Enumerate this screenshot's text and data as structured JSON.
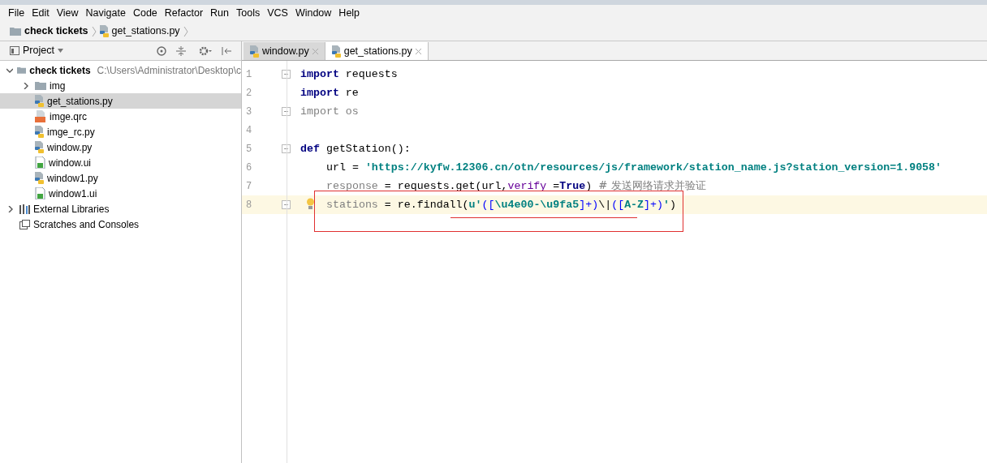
{
  "menu": [
    "File",
    "Edit",
    "View",
    "Navigate",
    "Code",
    "Refactor",
    "Run",
    "Tools",
    "VCS",
    "Window",
    "Help"
  ],
  "breadcrumb": [
    {
      "label": "check tickets",
      "kind": "folder"
    },
    {
      "label": "get_stations.py",
      "kind": "python"
    }
  ],
  "project_panel": {
    "title": "Project"
  },
  "tabs": [
    {
      "label": "window.py",
      "selected": false
    },
    {
      "label": "get_stations.py",
      "selected": true
    }
  ],
  "tree": [
    {
      "label": "check tickets",
      "path": "C:\\Users\\Administrator\\Desktop\\c",
      "kind": "folder",
      "expanded": true,
      "selected": false,
      "children": [
        {
          "label": "img",
          "kind": "folder",
          "expanded": false,
          "selected": false
        },
        {
          "label": "get_stations.py",
          "kind": "python",
          "selected": true
        },
        {
          "label": "imge.qrc",
          "kind": "qrc",
          "selected": false
        },
        {
          "label": "imge_rc.py",
          "kind": "python",
          "selected": false
        },
        {
          "label": "window.py",
          "kind": "python",
          "selected": false
        },
        {
          "label": "window.ui",
          "kind": "ui",
          "selected": false
        },
        {
          "label": "window1.py",
          "kind": "python",
          "selected": false
        },
        {
          "label": "window1.ui",
          "kind": "ui",
          "selected": false
        }
      ]
    },
    {
      "label": "External Libraries",
      "kind": "library",
      "expanded": false,
      "selected": false
    },
    {
      "label": "Scratches and Consoles",
      "kind": "scratch",
      "selected": false
    }
  ],
  "code_lines": [
    {
      "number": "1",
      "fold": true,
      "current": false,
      "indented": false,
      "tokens": [
        {
          "text": "import",
          "kind": "keyword"
        },
        {
          "text": " requests",
          "kind": "plain"
        }
      ]
    },
    {
      "number": "2",
      "fold": false,
      "current": false,
      "indented": false,
      "tokens": [
        {
          "text": "import",
          "kind": "keyword"
        },
        {
          "text": " re",
          "kind": "plain"
        }
      ]
    },
    {
      "number": "3",
      "fold": true,
      "current": false,
      "indented": false,
      "tokens": [
        {
          "text": "import os",
          "kind": "unused"
        }
      ]
    },
    {
      "number": "4",
      "fold": false,
      "current": false
    },
    {
      "number": "5",
      "fold": true,
      "current": false,
      "indented": false,
      "tokens": [
        {
          "text": "def",
          "kind": "keyword"
        },
        {
          "text": " getStation():",
          "kind": "plain"
        }
      ]
    },
    {
      "number": "6",
      "fold": false,
      "current": false,
      "indented": true,
      "tokens": [
        {
          "text": "url = ",
          "kind": "plain"
        },
        {
          "text": "'https://kyfw.12306.cn/otn/resources/js/framework/station_name.js?station_version=1.9058'",
          "kind": "string"
        }
      ]
    },
    {
      "number": "7",
      "fold": false,
      "current": false,
      "indented": true,
      "tokens": [
        {
          "text": "response",
          "kind": "unused"
        },
        {
          "text": " = requests.get(url,",
          "kind": "plain"
        },
        {
          "text": "verify",
          "kind": "param"
        },
        {
          "text": " =",
          "kind": "plain"
        },
        {
          "text": "True",
          "kind": "keyword"
        },
        {
          "text": ") ",
          "kind": "plain"
        },
        {
          "text": "# 发送网络请求并验证",
          "kind": "comment"
        }
      ]
    },
    {
      "number": "8",
      "fold": true,
      "current": true,
      "indented": true,
      "tokens": [
        {
          "text": "stations",
          "kind": "unused"
        },
        {
          "text": " = re.findall(",
          "kind": "plain"
        },
        {
          "text": "u'",
          "kind": "string"
        },
        {
          "text": "([",
          "kind": "regex"
        },
        {
          "text": "\\u4e00-\\u9fa5",
          "kind": "string"
        },
        {
          "text": "]+)",
          "kind": "regex"
        },
        {
          "text": "\\|",
          "kind": "plain"
        },
        {
          "text": "([",
          "kind": "regex"
        },
        {
          "text": "A-Z",
          "kind": "string"
        },
        {
          "text": "]+)",
          "kind": "regex"
        },
        {
          "text": "'",
          "kind": "string"
        },
        {
          "text": ")",
          "kind": "plain"
        }
      ]
    }
  ]
}
